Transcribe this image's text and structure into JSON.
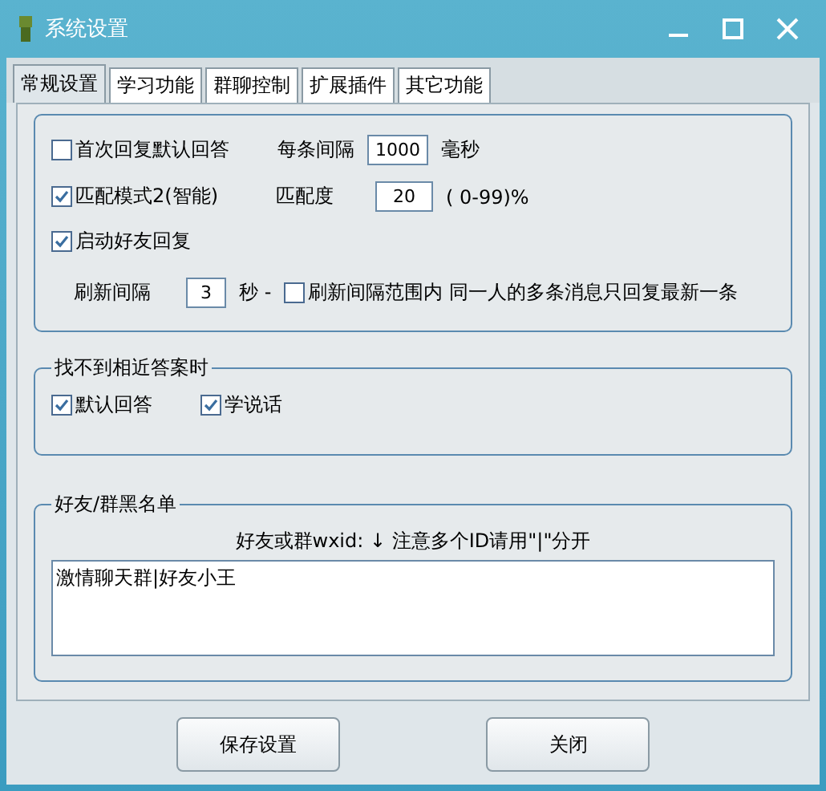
{
  "window": {
    "title": "系统设置"
  },
  "tabs": [
    {
      "label": "常规设置",
      "selected": true
    },
    {
      "label": "学习功能",
      "selected": false
    },
    {
      "label": "群聊控制",
      "selected": false
    },
    {
      "label": "扩展插件",
      "selected": false
    },
    {
      "label": "其它功能",
      "selected": false
    }
  ],
  "reply_options": {
    "first_reply": {
      "label": "首次回复默认回答",
      "checked": false
    },
    "interval_label": "每条间隔",
    "interval_value": "1000",
    "interval_unit": "毫秒",
    "match_mode": {
      "label": "匹配模式2(智能)",
      "checked": true
    },
    "match_label": "匹配度",
    "match_value": "20",
    "match_range": "( 0-99)%",
    "friend_reply": {
      "label": "启动好友回复",
      "checked": true
    },
    "refresh_label": "刷新间隔",
    "refresh_value": "3",
    "refresh_unit": "秒 -",
    "latest_only": {
      "label": "刷新间隔范围内 同一人的多条消息只回复最新一条",
      "checked": false
    }
  },
  "fallback": {
    "title": "找不到相近答案时",
    "options": [
      {
        "label": "默认回答",
        "checked": true
      },
      {
        "label": "学说话",
        "checked": true
      }
    ]
  },
  "blacklist": {
    "title": "好友/群黑名单",
    "hint": "好友或群wxid: ↓  注意多个ID请用\"|\"分开",
    "value": "激情聊天群|好友小王"
  },
  "buttons": [
    "保存设置",
    "关闭"
  ]
}
